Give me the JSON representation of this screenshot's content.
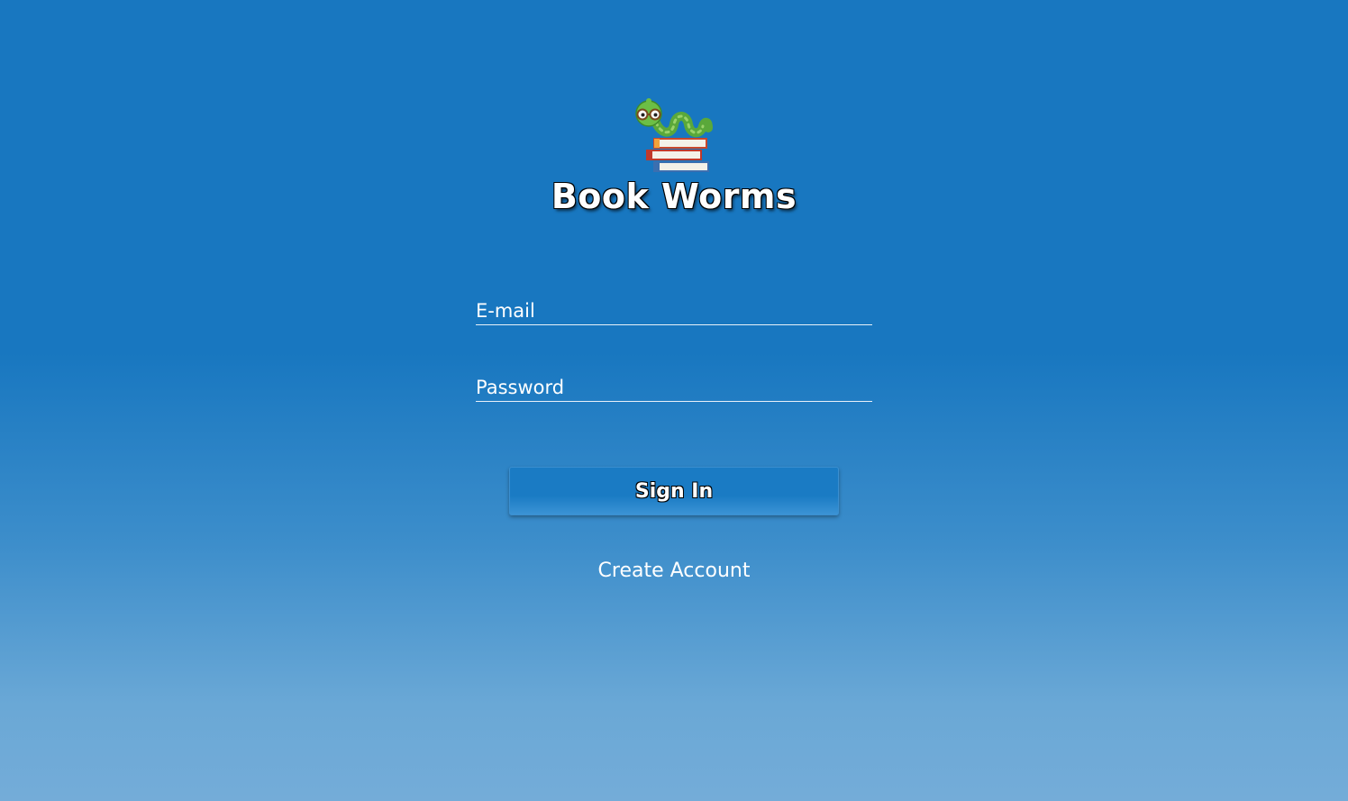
{
  "app": {
    "title": "Book Worms",
    "logo_icon": "bookworm-on-books-icon"
  },
  "form": {
    "email_placeholder": "E-mail",
    "email_value": "",
    "password_placeholder": "Password",
    "password_value": "",
    "signin_label": "Sign In",
    "create_account_label": "Create Account"
  },
  "colors": {
    "background_top": "#1877c0",
    "background_bottom": "#74acd8",
    "button": "#1a7bc4",
    "text": "#ffffff"
  }
}
